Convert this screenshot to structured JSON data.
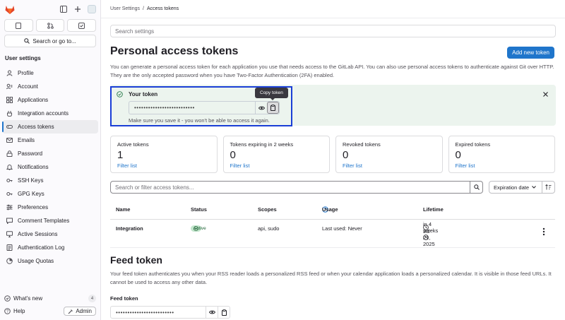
{
  "sidebar": {
    "search_label": "Search or go to...",
    "section_title": "User settings",
    "items": [
      {
        "label": "Profile",
        "icon": "profile-icon"
      },
      {
        "label": "Account",
        "icon": "account-icon"
      },
      {
        "label": "Applications",
        "icon": "applications-icon"
      },
      {
        "label": "Integration accounts",
        "icon": "integration-icon"
      },
      {
        "label": "Access tokens",
        "icon": "token-icon",
        "active": true
      },
      {
        "label": "Emails",
        "icon": "mail-icon"
      },
      {
        "label": "Password",
        "icon": "lock-icon"
      },
      {
        "label": "Notifications",
        "icon": "bell-icon"
      },
      {
        "label": "SSH Keys",
        "icon": "key-icon"
      },
      {
        "label": "GPG Keys",
        "icon": "key-icon"
      },
      {
        "label": "Preferences",
        "icon": "preferences-icon"
      },
      {
        "label": "Comment Templates",
        "icon": "comment-icon"
      },
      {
        "label": "Active Sessions",
        "icon": "monitor-icon"
      },
      {
        "label": "Authentication Log",
        "icon": "log-icon"
      },
      {
        "label": "Usage Quotas",
        "icon": "quota-icon"
      }
    ],
    "whats_new": "What's new",
    "whats_new_count": "4",
    "help": "Help",
    "admin": "Admin"
  },
  "breadcrumb": {
    "parent": "User Settings",
    "separator": "/",
    "current": "Access tokens"
  },
  "search_settings_placeholder": "Search settings",
  "page_title": "Personal access tokens",
  "add_token_label": "Add new token",
  "description": "You can generate a personal access token for each application you use that needs access to the GitLab API. You can also use personal access tokens to authenticate against Git over HTTP. They are the only accepted password when you have Two-Factor Authentication (2FA) enabled.",
  "token_alert": {
    "title": "Your token",
    "masked_value": "••••••••••••••••••••••••••",
    "hint": "Make sure you save it - you won't be able to access it again.",
    "tooltip": "Copy token"
  },
  "stats": [
    {
      "label": "Active tokens",
      "value": "1",
      "link": "Filter list"
    },
    {
      "label": "Tokens expiring in 2 weeks",
      "value": "0",
      "link": "Filter list"
    },
    {
      "label": "Revoked tokens",
      "value": "0",
      "link": "Filter list"
    },
    {
      "label": "Expired tokens",
      "value": "0",
      "link": "Filter list"
    }
  ],
  "filter": {
    "placeholder": "Search or filter access tokens...",
    "sort_label": "Expiration date"
  },
  "table": {
    "headers": {
      "name": "Name",
      "status": "Status",
      "scopes": "Scopes",
      "usage": "Usage",
      "lifetime": "Lifetime"
    },
    "rows": [
      {
        "name": "Integration",
        "status": "Active",
        "scopes": "api, sudo",
        "usage": "Last used: Never",
        "expires_in": "in 4 weeks",
        "expires_on": "Jul 21, 2025"
      }
    ]
  },
  "feed": {
    "title": "Feed token",
    "description": "Your feed token authenticates you when your RSS reader loads a personalized RSS feed or when your calendar application loads a personalized calendar. It is visible in those feed URLs. It cannot be used to access any other data.",
    "label": "Feed token",
    "masked_value": "•••••••••••••••••••••••••"
  },
  "colors": {
    "primary": "#1f75cb",
    "success_bg": "#ecf4ee",
    "highlight": "#1a3ed6"
  }
}
